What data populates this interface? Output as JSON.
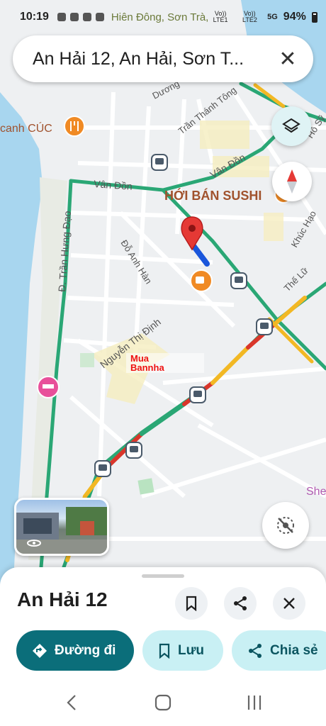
{
  "status_bar": {
    "time": "10:19",
    "location_hint": "Hiên Đông, Sơn Trà,...",
    "carrier1": "Vo)) LTE1",
    "carrier2": "Vo)) LTE2",
    "network": "5G",
    "battery": "94%"
  },
  "search": {
    "query": "An Hải 12, An Hải, Sơn T..."
  },
  "map": {
    "labels": {
      "van_don_west": "Vân Đồn",
      "van_don_east": "Vân Đồn",
      "tran_thanh_tong": "Trần Thánh Tông",
      "duong": "Dương",
      "ho_so": "Hồ Sỹ",
      "tran_hung_dao": "Đ. Trần Hưng Đạo",
      "do_anh_han": "Đỗ Anh Hàn",
      "nguyen_thi_dinh": "Nguyễn Thị Định",
      "the_lu": "Thế Lữ",
      "khuc_hao": "Khúc Hạo",
      "poi_sushi": "HỚI BÁN SUSHI",
      "poi_canh_cuc": "canh CÚC",
      "she": "She"
    },
    "watermark": {
      "line1": "Mua",
      "line2": "Bannha"
    },
    "colors": {
      "water": "#a8d6ef",
      "road_major": "#2aa775",
      "traffic_slow": "#f2b824",
      "traffic_heavy": "#d9362b",
      "pin": "#e53935",
      "route": "#1a56db",
      "poi_orange": "#f08a24"
    }
  },
  "sheet": {
    "place_name": "An Hải 12",
    "directions_label": "Đường đi",
    "save_label": "Lưu",
    "share_label": "Chia sẻ"
  }
}
